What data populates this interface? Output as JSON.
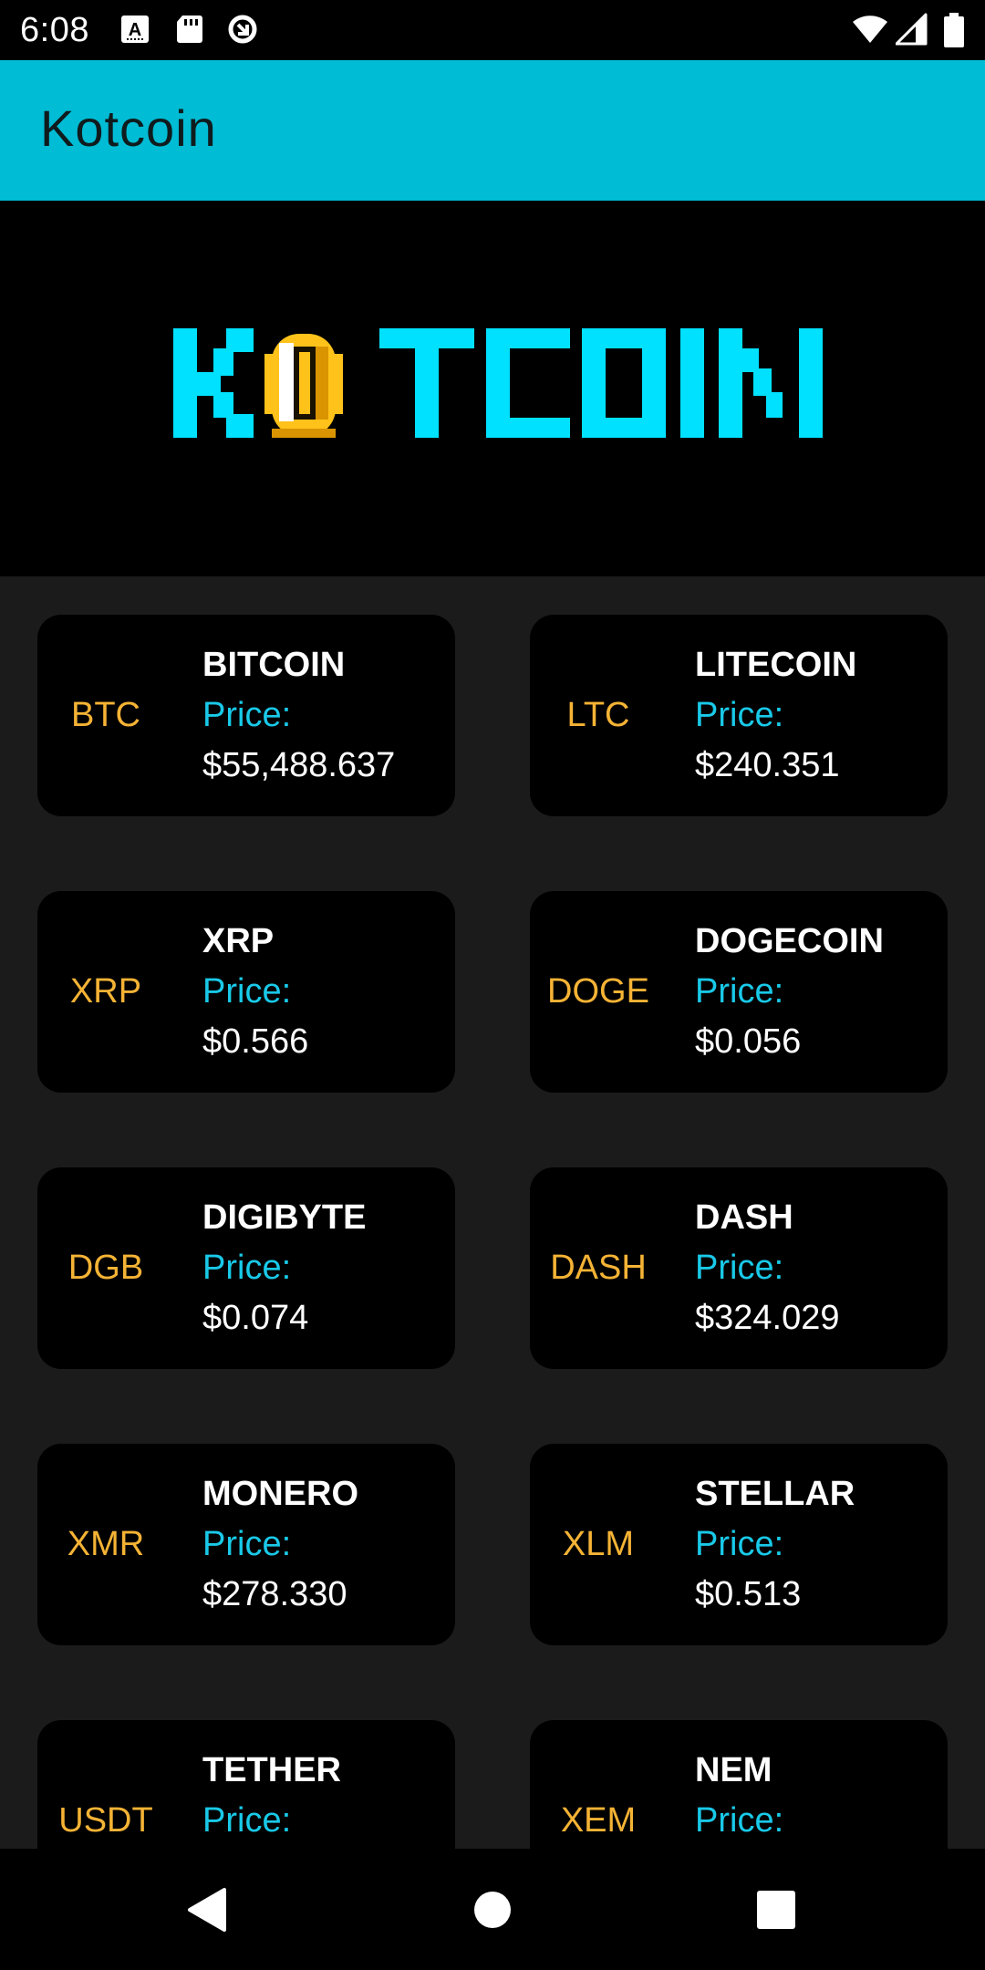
{
  "status_bar": {
    "time": "6:08",
    "icons": [
      "keyboard-a-icon",
      "sd-card-icon",
      "data-saver-icon",
      "wifi-icon",
      "signal-icon",
      "battery-icon"
    ]
  },
  "app_bar": {
    "title": "Kotcoin"
  },
  "banner": {
    "logo_text": "KOTCOIN",
    "logo_color": "#00e1ff",
    "coin_color": "#ffc21a"
  },
  "colors": {
    "accent": "#00bcd4",
    "symbol": "#f5b335",
    "price_label": "#19c9e8",
    "card_bg": "#000000",
    "page_bg": "#1b1b1b"
  },
  "coins": [
    {
      "symbol": "BTC",
      "name": "BITCOIN",
      "price_label": "Price:",
      "price": "$55,488.637"
    },
    {
      "symbol": "LTC",
      "name": "LITECOIN",
      "price_label": "Price:",
      "price": "$240.351"
    },
    {
      "symbol": "XRP",
      "name": "XRP",
      "price_label": "Price:",
      "price": "$0.566"
    },
    {
      "symbol": "DOGE",
      "name": "DOGECOIN",
      "price_label": "Price:",
      "price": "$0.056"
    },
    {
      "symbol": "DGB",
      "name": "DIGIBYTE",
      "price_label": "Price:",
      "price": "$0.074"
    },
    {
      "symbol": "DASH",
      "name": "DASH",
      "price_label": "Price:",
      "price": "$324.029"
    },
    {
      "symbol": "XMR",
      "name": "MONERO",
      "price_label": "Price:",
      "price": "$278.330"
    },
    {
      "symbol": "XLM",
      "name": "STELLAR",
      "price_label": "Price:",
      "price": "$0.513"
    },
    {
      "symbol": "USDT",
      "name": "TETHER",
      "price_label": "Price:",
      "price": ""
    },
    {
      "symbol": "XEM",
      "name": "NEM",
      "price_label": "Price:",
      "price": ""
    }
  ],
  "nav_bar": {
    "buttons": [
      "back-icon",
      "home-icon",
      "recents-icon"
    ]
  }
}
